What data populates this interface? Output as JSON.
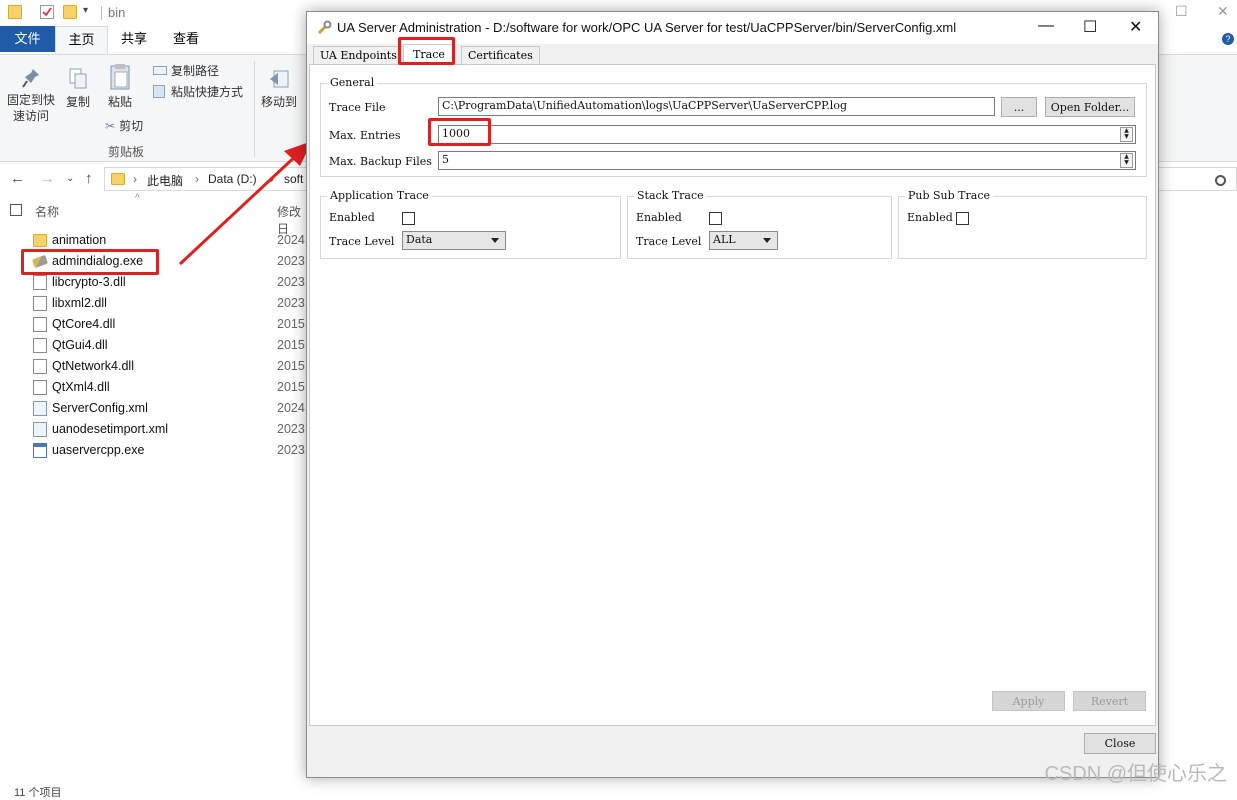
{
  "explorer": {
    "title": "bin",
    "ribbon_tabs": [
      "文件",
      "主页",
      "共享",
      "查看"
    ],
    "ribbon": {
      "pin_label_1": "固定到快",
      "pin_label_2": "速访问",
      "copy_label": "复制",
      "paste_label": "粘贴",
      "copy_path_label": "复制路径",
      "paste_shortcut_label": "粘贴快捷方式",
      "cut_label": "剪切",
      "clipboard_group": "剪贴板",
      "move_to_label": "移动到"
    },
    "breadcrumbs": [
      "此电脑",
      "Data (D:)",
      "soft"
    ],
    "columns": {
      "name": "名称",
      "date": "修改日"
    },
    "files": [
      {
        "name": "animation",
        "date": "2024,",
        "icon": "folder-icon"
      },
      {
        "name": "admindialog.exe",
        "date": "2023,",
        "icon": "wrench-exe-icon"
      },
      {
        "name": "libcrypto-3.dll",
        "date": "2023,",
        "icon": "dll-icon"
      },
      {
        "name": "libxml2.dll",
        "date": "2023,",
        "icon": "dll-icon"
      },
      {
        "name": "QtCore4.dll",
        "date": "2015,",
        "icon": "dll-icon"
      },
      {
        "name": "QtGui4.dll",
        "date": "2015,",
        "icon": "dll-icon"
      },
      {
        "name": "QtNetwork4.dll",
        "date": "2015,",
        "icon": "dll-icon"
      },
      {
        "name": "QtXml4.dll",
        "date": "2015,",
        "icon": "dll-icon"
      },
      {
        "name": "ServerConfig.xml",
        "date": "2024,",
        "icon": "xml-icon"
      },
      {
        "name": "uanodesetimport.xml",
        "date": "2023,",
        "icon": "xml-icon"
      },
      {
        "name": "uaservercpp.exe",
        "date": "2023,",
        "icon": "exe-icon"
      }
    ],
    "status": "11 个项目"
  },
  "dialog": {
    "title": "UA Server Administration - D:/software for work/OPC UA Server for test/UaCPPServer/bin/ServerConfig.xml",
    "tabs": [
      "UA Endpoints",
      "Trace",
      "Certificates"
    ],
    "active_tab": "Trace",
    "general": {
      "title": "General",
      "trace_file_label": "Trace File",
      "trace_file_value": "C:\\ProgramData\\UnifiedAutomation\\logs\\UaCPPServer\\UaServerCPP.log",
      "browse_label": "...",
      "open_folder_label": "Open Folder...",
      "max_entries_label": "Max. Entries",
      "max_entries_value": "1000",
      "max_backup_label": "Max. Backup Files",
      "max_backup_value": "5"
    },
    "app_trace": {
      "title": "Application Trace",
      "enabled_label": "Enabled",
      "level_label": "Trace Level",
      "level_value": "Data"
    },
    "stack_trace": {
      "title": "Stack Trace",
      "enabled_label": "Enabled",
      "level_label": "Trace Level",
      "level_value": "ALL"
    },
    "pubsub_trace": {
      "title": "Pub Sub Trace",
      "enabled_label": "Enabled"
    },
    "apply_label": "Apply",
    "revert_label": "Revert",
    "close_label": "Close"
  },
  "watermark": "CSDN @但使心乐之",
  "colors": {
    "highlight": "#e02020",
    "file_tab": "#1f5ba6"
  }
}
